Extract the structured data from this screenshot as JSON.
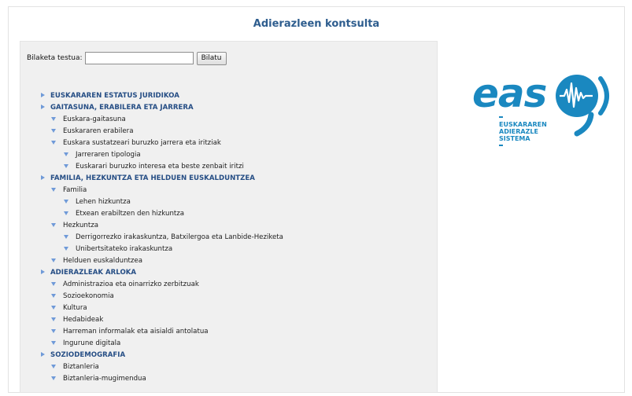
{
  "page": {
    "title": "Adierazleen kontsulta"
  },
  "search": {
    "label": "Bilaketa testua:",
    "value": "",
    "button_label": "Bilatu"
  },
  "tree": [
    {
      "level": 0,
      "label": "EUSKARAREN ESTATUS JURIDIKOA"
    },
    {
      "level": 0,
      "label": "GAITASUNA, ERABILERA ETA JARRERA"
    },
    {
      "level": 1,
      "label": "Euskara-gaitasuna"
    },
    {
      "level": 1,
      "label": "Euskararen erabilera"
    },
    {
      "level": 1,
      "label": "Euskara sustatzeari buruzko jarrera eta iritziak"
    },
    {
      "level": 2,
      "label": "Jarreraren tipologia"
    },
    {
      "level": 2,
      "label": "Euskarari buruzko interesa eta beste zenbait iritzi"
    },
    {
      "level": 0,
      "label": "FAMILIA, HEZKUNTZA ETA HELDUEN EUSKALDUNTZEA"
    },
    {
      "level": 1,
      "label": "Familia"
    },
    {
      "level": 2,
      "label": "Lehen hizkuntza"
    },
    {
      "level": 2,
      "label": "Etxean erabiltzen den hizkuntza"
    },
    {
      "level": 1,
      "label": "Hezkuntza"
    },
    {
      "level": 2,
      "label": "Derrigorrezko irakaskuntza, Batxilergoa eta Lanbide-Heziketa"
    },
    {
      "level": 2,
      "label": "Unibertsitateko irakaskuntza"
    },
    {
      "level": 1,
      "label": "Helduen euskalduntzea"
    },
    {
      "level": 0,
      "label": "ADIERAZLEAK ARLOKA"
    },
    {
      "level": 1,
      "label": "Administrazioa eta oinarrizko zerbitzuak"
    },
    {
      "level": 1,
      "label": "Sozioekonomia"
    },
    {
      "level": 1,
      "label": "Kultura"
    },
    {
      "level": 1,
      "label": "Hedabideak"
    },
    {
      "level": 1,
      "label": "Harreman informalak eta aisialdi antolatua"
    },
    {
      "level": 1,
      "label": "Ingurune digitala"
    },
    {
      "level": 0,
      "label": "SOZIODEMOGRAFIA"
    },
    {
      "level": 1,
      "label": "Biztanleria"
    },
    {
      "level": 1,
      "label": "Biztanleria-mugimendua"
    }
  ],
  "logo": {
    "word": "eas",
    "lines": [
      "EUSKARAREN",
      "ADIERAZLE",
      "SISTEMA"
    ],
    "color": "#1a88c0"
  },
  "colors": {
    "heading": "#2e5d8e",
    "category": "#264e85",
    "arrow": "#6f9ad8",
    "panel": "#f0f0f0"
  }
}
